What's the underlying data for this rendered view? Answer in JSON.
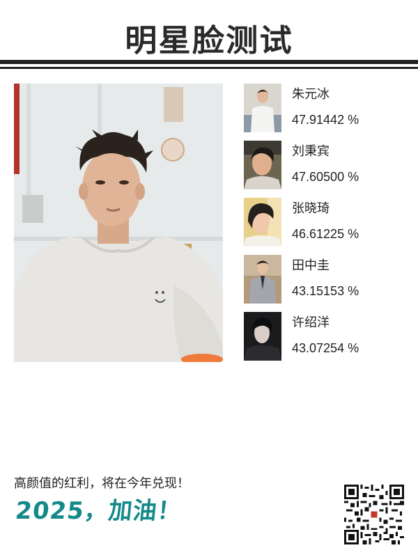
{
  "header": {
    "title": "明星脸测试"
  },
  "main_photo": {
    "icon": "user-photo"
  },
  "results": [
    {
      "name": "朱元冰",
      "score": "47.91442 %"
    },
    {
      "name": "刘秉宾",
      "score": "47.60500 %"
    },
    {
      "name": "张晓琦",
      "score": "46.61225 %"
    },
    {
      "name": "田中圭",
      "score": "43.15153 %"
    },
    {
      "name": "许绍洋",
      "score": "43.07254 %"
    }
  ],
  "footer": {
    "slogan": "高颜值的红利，将在今年兑现！",
    "cheer": "2025，加油！",
    "qr_icon": "qr-code-icon"
  },
  "colors": {
    "title": "#2a2a2a",
    "accent": "#14898a",
    "rule": "#222222",
    "background": "#ffffff"
  }
}
